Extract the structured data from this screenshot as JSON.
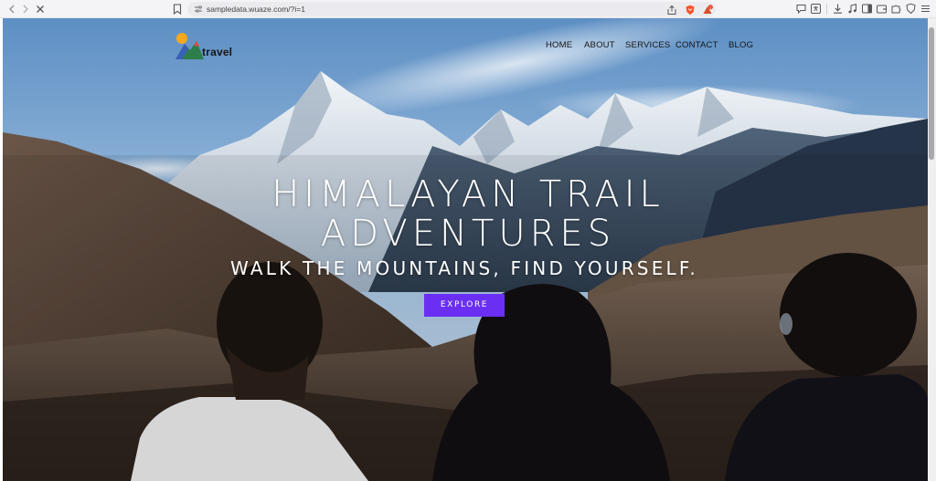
{
  "browser": {
    "url": "sampledata.wuaze.com/?i=1",
    "icons": {
      "back": "chevron-left-icon",
      "forward": "chevron-right-icon",
      "stop": "close-icon",
      "bookmark": "bookmark-icon",
      "site_info": "site-info-icon",
      "share": "share-icon",
      "shields": "brave-shields-icon",
      "rewards": "brave-rewards-icon",
      "rewards_badge": "1"
    }
  },
  "site": {
    "logo_text": "travel",
    "nav": [
      "HOME",
      "ABOUT",
      "SERVICES",
      "CONTACT",
      "BLOG"
    ]
  },
  "hero": {
    "title_line1": "HIMALAYAN TRAIL",
    "title_line2": "ADVENTURES",
    "tagline": "WALK THE MOUNTAINS, FIND YOURSELF.",
    "cta": "EXPLORE"
  },
  "colors": {
    "cta": "#6a2ff2",
    "sky": "#8cb3d8",
    "snow": "#e9eef3"
  }
}
